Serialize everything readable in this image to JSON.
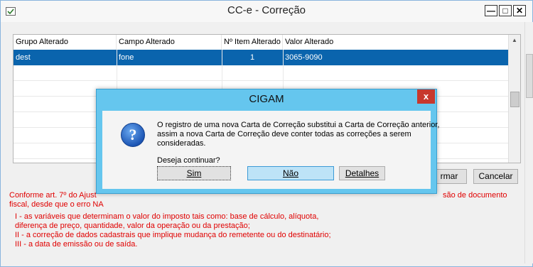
{
  "window": {
    "title": "CC-e - Correção"
  },
  "grid": {
    "columns": [
      "Grupo Alterado",
      "Campo Alterado",
      "Nº Item Alterado",
      "Valor Alterado"
    ],
    "rows": [
      {
        "grupo": "dest",
        "campo": "fone",
        "item": "1",
        "valor": "3065-9090"
      }
    ]
  },
  "buttons": {
    "confirm_partial": "rmar",
    "cancel": "Cancelar"
  },
  "notes": {
    "line1_left": "Conforme art. 7º do Ajust",
    "line1_right": "são de documento",
    "line2": "fiscal, desde que o erro NA",
    "item1": "I - as variáveis que determinam o valor do imposto tais como: base de cálculo, alíquota,",
    "item1b": "diferença de  preço, quantidade, valor da operação ou da prestação;",
    "item2": "II - a correção de dados cadastrais que implique mudança do remetente ou do destinatário;",
    "item3": "III - a data de emissão ou de saída."
  },
  "dialog": {
    "title": "CIGAM",
    "message_line1": "O registro de uma nova Carta de Correção substitui a Carta de Correção anterior,",
    "message_line2": "assim a nova Carta de Correção deve conter todas as correções a serem",
    "message_line3": "consideradas.",
    "question": "Deseja continuar?",
    "btn_yes": "Sim",
    "btn_no": "Não",
    "btn_details": "Detalhes",
    "close_glyph": "x",
    "icon_glyph": "?"
  },
  "colors": {
    "selection": "#0a64ad",
    "dialog_frame": "#65c6ee",
    "note_text": "#e00000"
  }
}
